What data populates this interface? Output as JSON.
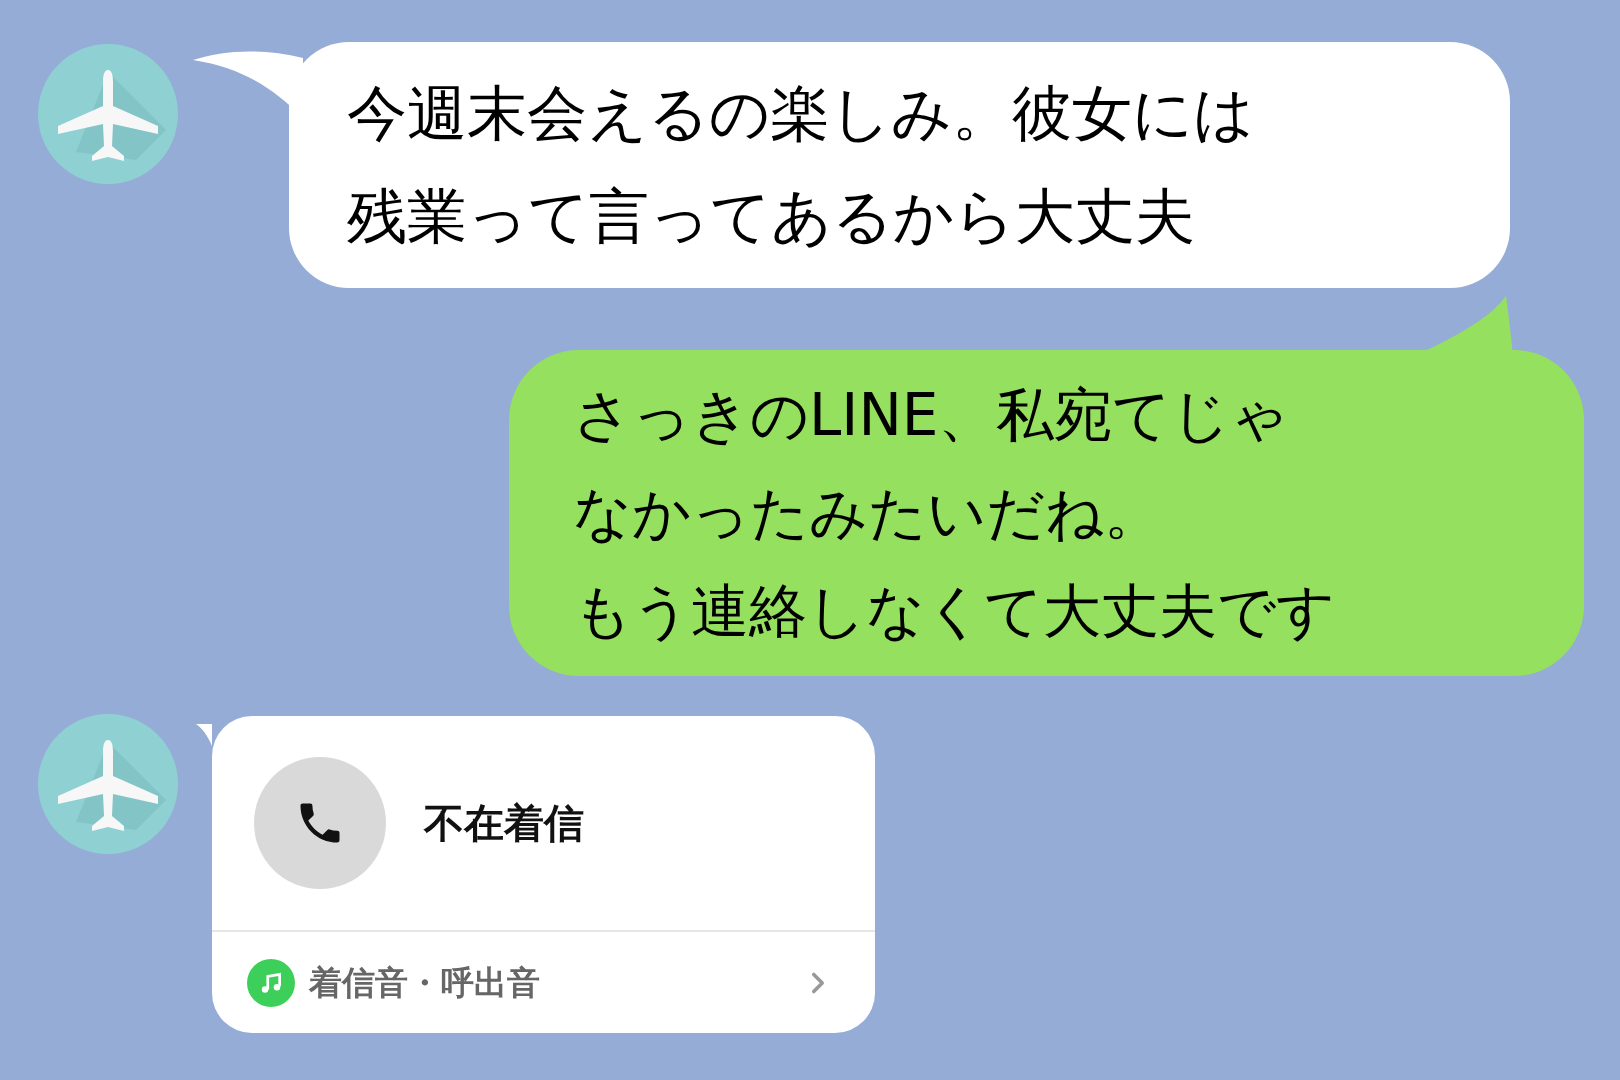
{
  "messages": [
    {
      "kind": "text",
      "outgoing": false,
      "lines": [
        "今週末会えるの楽しみ。彼女には",
        "残業って言ってあるから大丈夫"
      ]
    },
    {
      "kind": "text",
      "outgoing": true,
      "lines": [
        "さっきのLINE、私宛てじゃ",
        "なかったみたいだね。",
        "もう連絡しなくて大丈夫です"
      ]
    },
    {
      "kind": "call",
      "outgoing": false,
      "title": "不在着信",
      "footer": "着信音・呼出音"
    }
  ]
}
